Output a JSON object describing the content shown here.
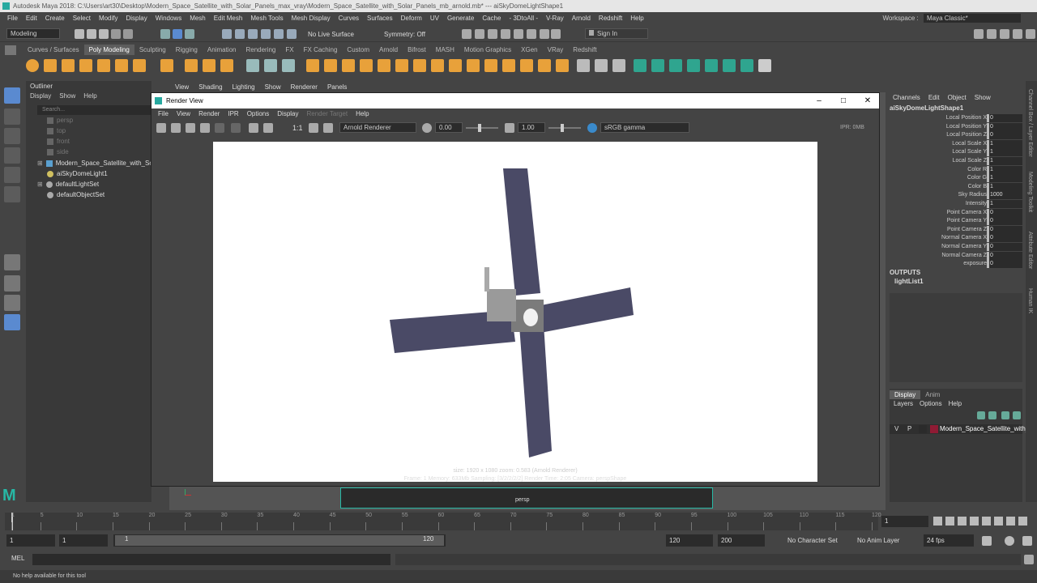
{
  "window": {
    "title": "Autodesk Maya 2018: C:\\Users\\art30\\Desktop\\Modern_Space_Satellite_with_Solar_Panels_max_vray\\Modern_Space_Satellite_with_Solar_Panels_mb_arnold.mb*  ---  aiSkyDomeLightShape1"
  },
  "menubar": [
    "File",
    "Edit",
    "Create",
    "Select",
    "Modify",
    "Display",
    "Windows",
    "Mesh",
    "Edit Mesh",
    "Mesh Tools",
    "Mesh Display",
    "Curves",
    "Surfaces",
    "Deform",
    "UV",
    "Generate",
    "Cache",
    "- 3DtoAll -",
    "V-Ray",
    "Arnold",
    "Redshift",
    "Help"
  ],
  "workspace": {
    "label": "Workspace :",
    "value": "Maya Classic*"
  },
  "statusline": {
    "mode": "Modeling",
    "live_surface": "No Live Surface",
    "symmetry": "Symmetry: Off",
    "sign_in": "Sign In"
  },
  "shelf_tabs": [
    "Curves / Surfaces",
    "Poly Modeling",
    "Sculpting",
    "Rigging",
    "Animation",
    "Rendering",
    "FX",
    "FX Caching",
    "Custom",
    "Arnold",
    "Bifrost",
    "MASH",
    "Motion Graphics",
    "XGen",
    "VRay",
    "Redshift"
  ],
  "shelf_active": "Poly Modeling",
  "outliner": {
    "title": "Outliner",
    "menu": [
      "Display",
      "Show",
      "Help"
    ],
    "search_placeholder": "Search...",
    "items": [
      "persp",
      "top",
      "front",
      "side",
      "Modern_Space_Satellite_with_Sol...",
      "aiSkyDomeLight1",
      "defaultLightSet",
      "defaultObjectSet"
    ]
  },
  "viewport_menu": [
    "View",
    "Shading",
    "Lighting",
    "Show",
    "Renderer",
    "Panels"
  ],
  "viewport_label": "persp",
  "render_view": {
    "title": "Render View",
    "menu": [
      "File",
      "View",
      "Render",
      "IPR",
      "Options",
      "Display",
      "Render Target",
      "Help"
    ],
    "renderer": "Arnold Renderer",
    "exposure": "0.00",
    "gamma": "1.00",
    "ratio": "1:1",
    "colorspace": "sRGB gamma",
    "ipr": "IPR: 0MB",
    "info1": "size: 1920 x 1080  zoom: 0.583     (Arnold Renderer)",
    "info2": "Frame: 1     Memory: 633Mb     Sampling: [3/2/2/2/2]     Render Time: 2:05     Camera: perspShape"
  },
  "channel_box": {
    "menu": [
      "Channels",
      "Edit",
      "Object",
      "Show"
    ],
    "object": "aiSkyDomeLightShape1",
    "attrs": [
      {
        "k": "Local Position X",
        "v": "0"
      },
      {
        "k": "Local Position Y",
        "v": "0"
      },
      {
        "k": "Local Position Z",
        "v": "0"
      },
      {
        "k": "Local Scale X",
        "v": "1"
      },
      {
        "k": "Local Scale Y",
        "v": "1"
      },
      {
        "k": "Local Scale Z",
        "v": "1"
      },
      {
        "k": "Color R",
        "v": "1"
      },
      {
        "k": "Color G",
        "v": "1"
      },
      {
        "k": "Color B",
        "v": "1"
      },
      {
        "k": "Sky Radius",
        "v": "1000"
      },
      {
        "k": "Intensity",
        "v": "1"
      },
      {
        "k": "Point Camera X",
        "v": "0"
      },
      {
        "k": "Point Camera Y",
        "v": "0"
      },
      {
        "k": "Point Camera Z",
        "v": "0"
      },
      {
        "k": "Normal Camera X",
        "v": "0"
      },
      {
        "k": "Normal Camera Y",
        "v": "0"
      },
      {
        "k": "Normal Camera Z",
        "v": "0"
      },
      {
        "k": "exposure",
        "v": "0"
      }
    ],
    "outputs_label": "OUTPUTS",
    "outputs_item": "lightList1"
  },
  "layer_editor": {
    "tabs": [
      "Display",
      "Anim"
    ],
    "menu": [
      "Layers",
      "Options",
      "Help"
    ],
    "layer": {
      "v": "V",
      "p": "P",
      "name": "Modern_Space_Satellite_with_"
    }
  },
  "side_tabs": [
    "Channel Box / Layer Editor",
    "Modeling Toolkit",
    "Attribute Editor",
    "Human IK"
  ],
  "timeline": {
    "ticks": [
      "1",
      "5",
      "10",
      "15",
      "20",
      "25",
      "30",
      "35",
      "40",
      "45",
      "50",
      "55",
      "60",
      "65",
      "70",
      "75",
      "80",
      "85",
      "90",
      "95",
      "100",
      "105",
      "110",
      "115",
      "120"
    ],
    "current_frame": "1"
  },
  "range": {
    "start": "1",
    "start2": "1",
    "slider_start": "1",
    "slider_end": "120",
    "end": "120",
    "end2": "200",
    "character_set": "No Character Set",
    "anim_layer": "No Anim Layer",
    "fps": "24 fps"
  },
  "cmdline": {
    "label": "MEL"
  },
  "helpline": "No help available for this tool",
  "colors": {
    "maya_teal": "#27a9a0",
    "panel": "#444444",
    "dark_field": "#2b2b2b",
    "shelf_orange": "#e8a13a",
    "shelf_green": "#2fa58f",
    "panel_blue": "#4a4a66",
    "layer_red": "#8f1b34"
  }
}
